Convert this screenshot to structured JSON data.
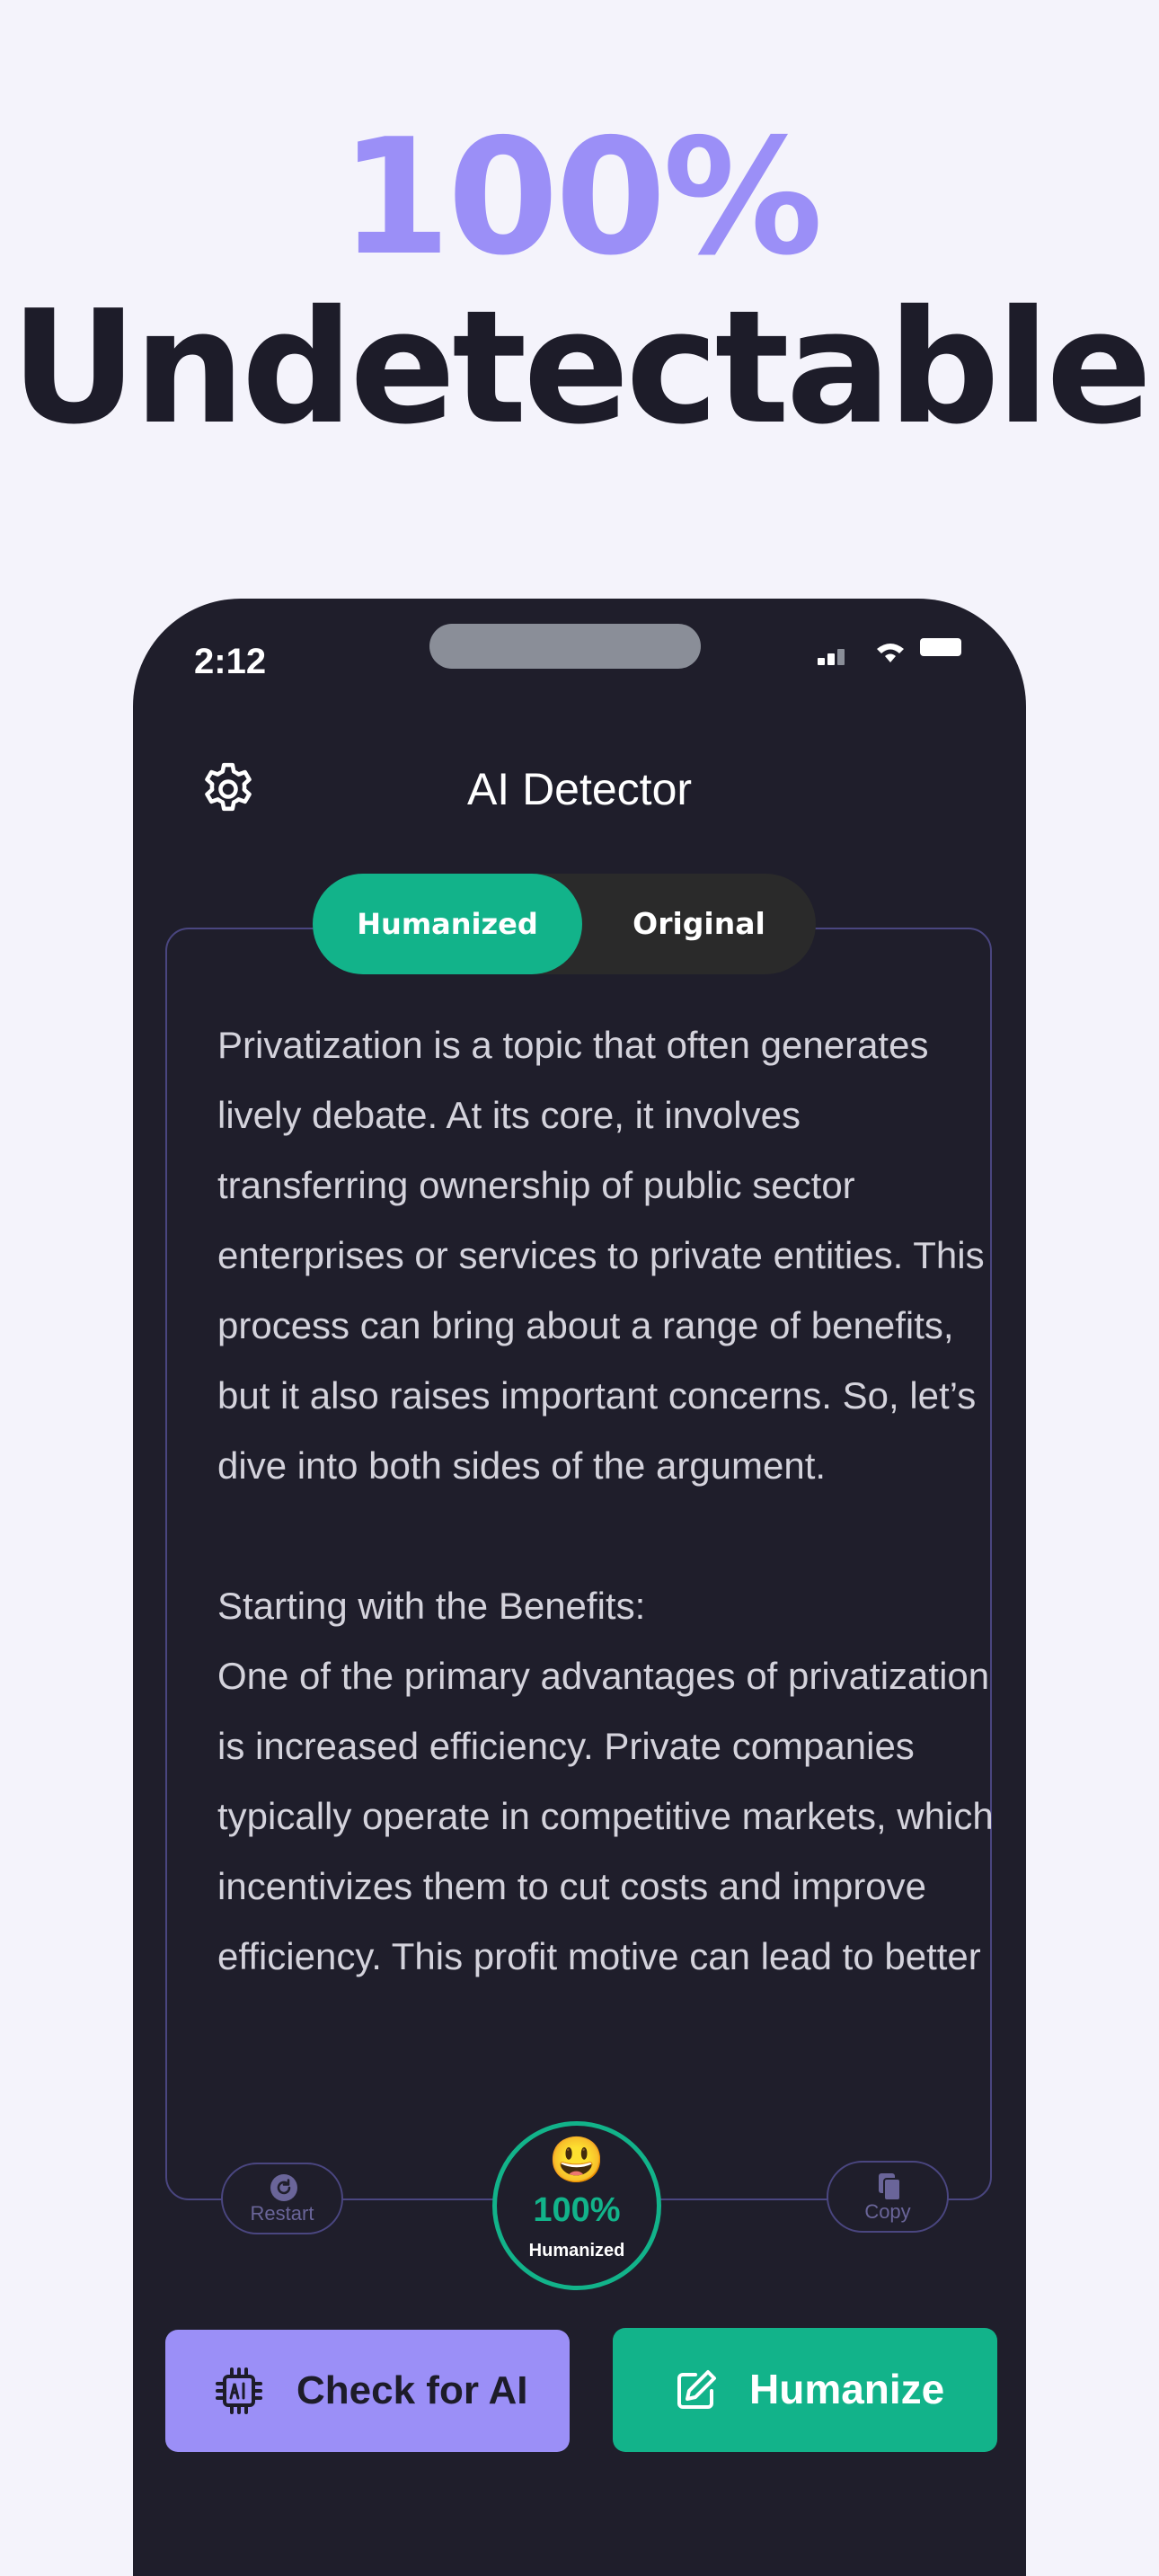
{
  "hero": {
    "accent_line": "100%",
    "main_line": "Undetectable"
  },
  "status_bar": {
    "time": "2:12"
  },
  "header": {
    "title": "AI Detector",
    "settings_icon": "gear-icon"
  },
  "segmented_control": {
    "active_label": "Humanized",
    "inactive_label": "Original"
  },
  "content": {
    "paragraph_1": "Privatization is a topic that often generates lively debate. At its core, it involves transferring ownership of public sector enterprises or services to private entities. This process can bring about a range of benefits, but it also raises important concerns. So, let’s dive into both sides of the argument.",
    "paragraph_2_heading": "Starting with the Benefits:",
    "paragraph_2": "One of the primary advantages of privatization is increased efficiency. Private companies typically operate in competitive markets, which incentivizes them to cut costs and improve efficiency. This profit motive can lead to better"
  },
  "actions": {
    "restart_label": "Restart",
    "copy_label": "Copy"
  },
  "score": {
    "emoji": "😃",
    "value": "100%",
    "label": "Humanized",
    "level_fraction": 1.0
  },
  "buttons": {
    "check_label": "Check for AI",
    "humanize_label": "Humanize"
  },
  "colors": {
    "background": "#f4f3fb",
    "accent_purple": "#9b8ff7",
    "accent_green": "#12b38a",
    "phone_body": "#1f1e2b",
    "heading_dark": "#1d1c29"
  }
}
